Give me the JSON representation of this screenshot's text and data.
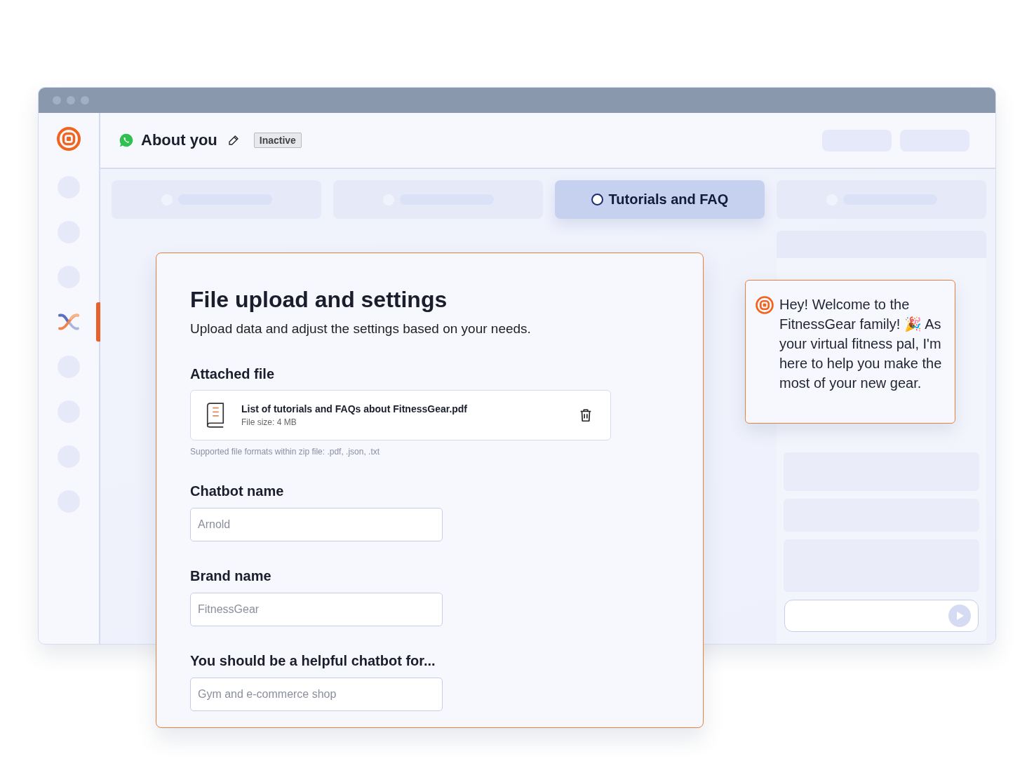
{
  "header": {
    "title": "About you",
    "status": "Inactive"
  },
  "sidebar": {
    "items": [
      {
        "kind": "placeholder",
        "selected": false
      },
      {
        "kind": "placeholder",
        "selected": false
      },
      {
        "kind": "placeholder",
        "selected": false
      },
      {
        "kind": "app",
        "selected": true
      },
      {
        "kind": "placeholder",
        "selected": false
      },
      {
        "kind": "placeholder",
        "selected": false
      },
      {
        "kind": "placeholder",
        "selected": false
      },
      {
        "kind": "placeholder",
        "selected": false
      }
    ]
  },
  "tabs": [
    {
      "kind": "placeholder",
      "selected": false
    },
    {
      "kind": "placeholder",
      "selected": false
    },
    {
      "kind": "label",
      "label": "Tutorials and FAQ",
      "selected": true
    },
    {
      "kind": "placeholder",
      "selected": false
    }
  ],
  "form": {
    "title": "File upload and settings",
    "subtitle": "Upload data and adjust the settings based on your needs.",
    "attached_file": {
      "label": "Attached file",
      "name": "List of tutorials and FAQs about FitnessGear.pdf",
      "size": "File size: 4 MB",
      "hint": "Supported file formats within zip file: .pdf, .json, .txt"
    },
    "fields": [
      {
        "label": "Chatbot name",
        "placeholder": "Arnold"
      },
      {
        "label": "Brand name",
        "placeholder": "FitnessGear"
      },
      {
        "label": "You should be a helpful chatbot for...",
        "placeholder": "Gym and e-commerce shop"
      }
    ]
  },
  "chat": {
    "message": "Hey! Welcome to the FitnessGear family! 🎉 As your virtual fitness pal, I'm here to help you make the most of your new gear."
  }
}
